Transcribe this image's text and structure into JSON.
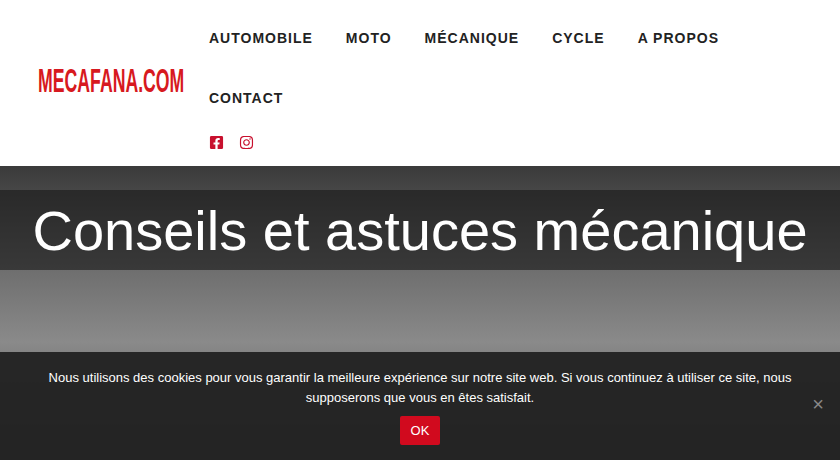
{
  "site": {
    "logo": "MECAFANA.COM"
  },
  "nav": {
    "items": [
      {
        "label": "AUTOMOBILE"
      },
      {
        "label": "MOTO"
      },
      {
        "label": "MÉCANIQUE"
      },
      {
        "label": "CYCLE"
      },
      {
        "label": "A PROPOS"
      },
      {
        "label": "CONTACT"
      }
    ]
  },
  "hero": {
    "title": "Conseils et astuces mécanique"
  },
  "cookie": {
    "message": "Nous utilisons des cookies pour vous garantir la meilleure expérience sur notre site web. Si vous continuez à utiliser ce site, nous supposerons que vous en êtes satisfait.",
    "button": "OK",
    "close": "×"
  }
}
